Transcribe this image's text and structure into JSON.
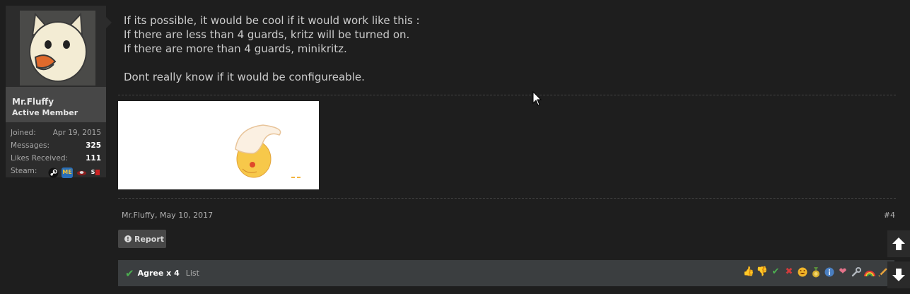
{
  "user": {
    "name": "Mr.Fluffy",
    "title": "Active Member",
    "stats": [
      {
        "label": "Joined:",
        "value": "Apr 19, 2015",
        "bold": false
      },
      {
        "label": "Messages:",
        "value": "325",
        "bold": true
      },
      {
        "label": "Likes Received:",
        "value": "111",
        "bold": true
      }
    ],
    "steam_label": "Steam:",
    "steam_icons": [
      "steam-icon",
      "me-badge-icon",
      "tf2-icon",
      "sm-icon"
    ],
    "me_badge_text": "ME",
    "sm_text": "S"
  },
  "message": {
    "lines": [
      "If its possible, it would be cool if it would work like this :",
      "If there are less than 4 guards, kritz will be turned on.",
      "If there are more than 4 guards, minikritz.",
      "Dont really know if it would be configureable."
    ]
  },
  "meta": {
    "author": "Mr.Fluffy",
    "date": "May 10, 2017",
    "permalink": "#4",
    "report_label": "Report"
  },
  "ratings": {
    "agree_label": "Agree x 4",
    "list_label": "List",
    "icons": [
      "thumbs-up-icon",
      "thumbs-down-icon",
      "check-icon",
      "cross-icon",
      "funny-face-icon",
      "winner-medal-icon",
      "info-icon",
      "heart-icon",
      "wrench-icon",
      "rainbow-icon",
      "pencil-icon"
    ]
  },
  "colors": {
    "background": "#1e1e1e",
    "sidebar": "#2c2c2c",
    "name_box": "#474747",
    "ratings_bar": "#3b3e40",
    "agree_green": "#4caf50"
  }
}
